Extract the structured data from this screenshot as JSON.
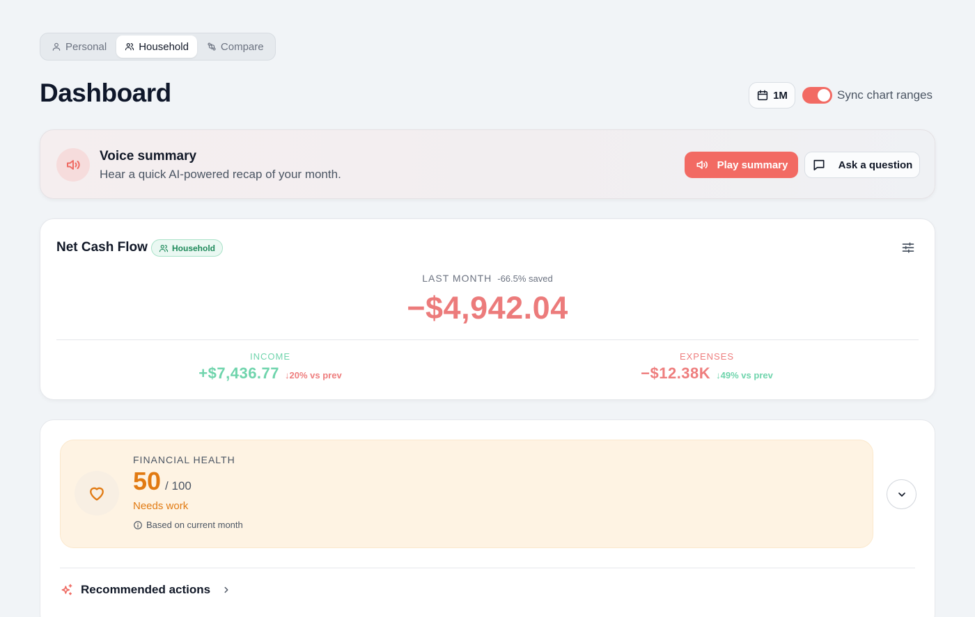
{
  "view_tabs": [
    {
      "label": "Personal",
      "icon": "user-icon",
      "active": false
    },
    {
      "label": "Household",
      "icon": "users-icon",
      "active": true
    },
    {
      "label": "Compare",
      "icon": "compare-icon",
      "active": false
    }
  ],
  "page": {
    "title": "Dashboard"
  },
  "controls": {
    "range_label": "1M",
    "sync_label": "Sync chart ranges",
    "sync_on": true
  },
  "voice_summary": {
    "title": "Voice summary",
    "subtitle": "Hear a quick AI-powered recap of your month.",
    "play_label": "Play summary",
    "ask_label": "Ask a question"
  },
  "net_cash_flow": {
    "title": "Net Cash Flow",
    "badge": "Household",
    "period_label": "LAST MONTH",
    "saved_text": "-66.5% saved",
    "value": "−$4,942.04",
    "income": {
      "label": "INCOME",
      "value": "+$7,436.77",
      "change": "↓20% vs prev"
    },
    "expenses": {
      "label": "EXPENSES",
      "value": "−$12.38K",
      "change": "↓49% vs prev"
    }
  },
  "financial_health": {
    "label": "FINANCIAL HEALTH",
    "score": "50",
    "max": "/ 100",
    "status": "Needs work",
    "basis": "Based on current month",
    "recommended_label": "Recommended actions"
  },
  "colors": {
    "accent": "#f26a63",
    "negative": "#ec7b7b",
    "positive": "#6fd4ac",
    "health_warning": "#e17a12"
  }
}
